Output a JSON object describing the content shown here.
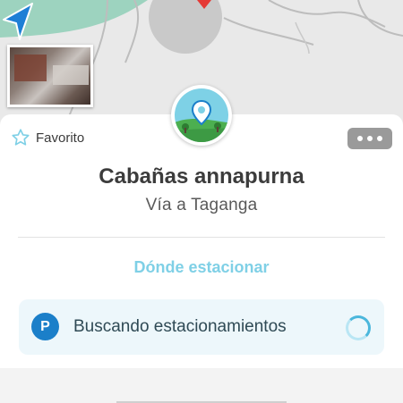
{
  "map": {
    "nav_arrow_icon": "navigation-arrow-icon",
    "destination_color": "#e53935",
    "water_color": "#9dd3bf"
  },
  "place": {
    "favorite_label": "Favorito",
    "name": "Cabañas annapurna",
    "address": "Vía a Taganga",
    "more_icon": "more-dots-icon",
    "badge_icon": "location-pin-icon"
  },
  "parking": {
    "link_label": "Dónde estacionar",
    "icon_letter": "P",
    "status_text": "Buscando estacionamientos",
    "accent_color": "#1b7fc9"
  }
}
